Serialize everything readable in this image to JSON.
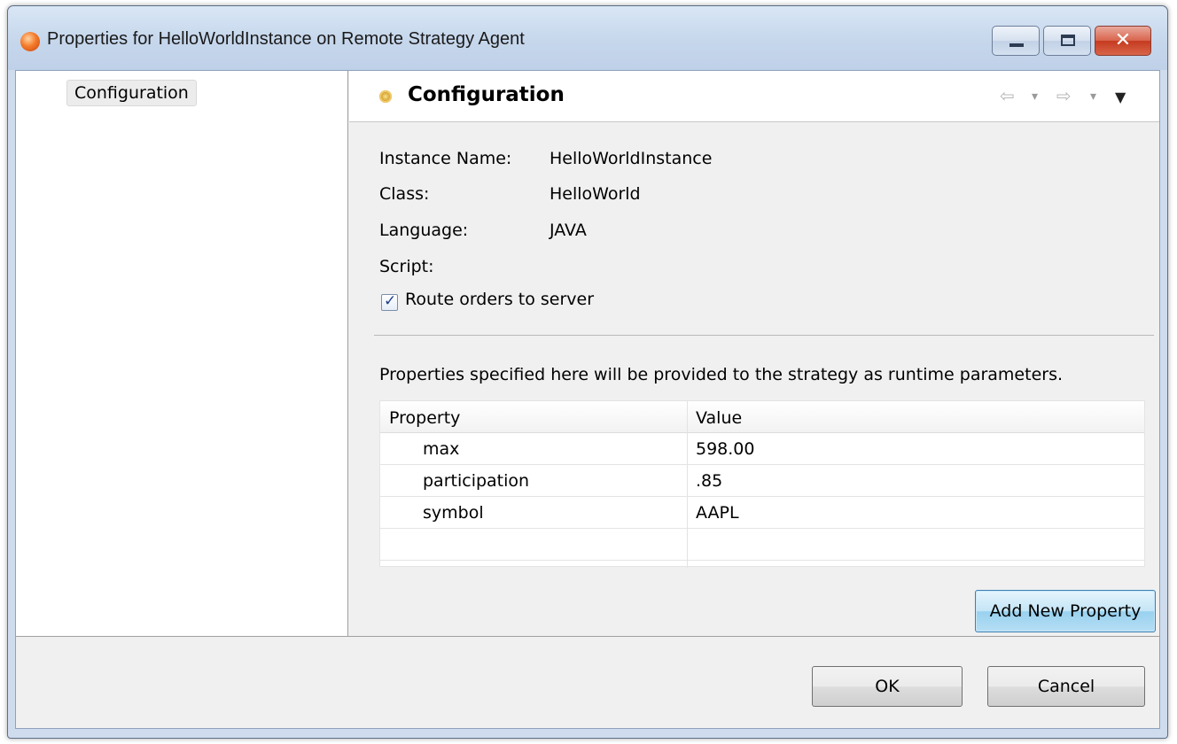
{
  "window": {
    "title": "Properties for HelloWorldInstance on Remote Strategy Agent",
    "close_glyph": "✕"
  },
  "nav": {
    "items": [
      {
        "label": "Configuration",
        "selected": true
      }
    ]
  },
  "page": {
    "title": "Configuration",
    "header_icons": [
      "back-arrow-icon",
      "back-dropdown-icon",
      "forward-arrow-icon",
      "forward-dropdown-icon",
      "view-menu-icon"
    ],
    "back_glyph": "⇦",
    "forward_glyph": "⇨",
    "dropdown_glyph": "▾",
    "menu_glyph": "▼",
    "fields": {
      "instance_name_label": "Instance Name:",
      "instance_name_value": "HelloWorldInstance",
      "class_label": "Class:",
      "class_value": "HelloWorld",
      "language_label": "Language:",
      "language_value": "JAVA",
      "script_label": "Script:"
    },
    "route_orders": {
      "label": "Route orders to server",
      "checked": true,
      "check_glyph": "✓"
    },
    "description": "Properties specified here will be provided to the strategy as runtime parameters.",
    "table": {
      "headers": [
        "Property",
        "Value"
      ],
      "rows": [
        {
          "property": "max",
          "value": "598.00"
        },
        {
          "property": "participation",
          "value": ".85"
        },
        {
          "property": "symbol",
          "value": "AAPL"
        },
        {
          "property": "",
          "value": ""
        }
      ]
    },
    "add_button_label": "Add New Property"
  },
  "footer": {
    "ok_label": "OK",
    "cancel_label": "Cancel"
  },
  "colors": {
    "window_frame": "#cfdced",
    "close_button": "#c63a1f",
    "focus_button": "#98d1ef"
  }
}
